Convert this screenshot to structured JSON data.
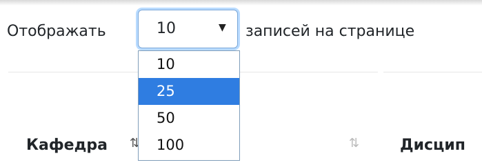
{
  "length_control": {
    "label_before": "Отображать",
    "selected_value": "10",
    "label_after": "записей на странице",
    "options": [
      "10",
      "25",
      "50",
      "100"
    ],
    "highlighted_option": "25"
  },
  "table_headers": [
    {
      "label": "Кафедра",
      "sort_icon": "sort-icon"
    },
    {
      "label": "Дисцип"
    }
  ],
  "colors": {
    "focus_border": "#7aa7d8",
    "highlight": "#2f7de1",
    "muted_icon": "#bbbbbb"
  }
}
